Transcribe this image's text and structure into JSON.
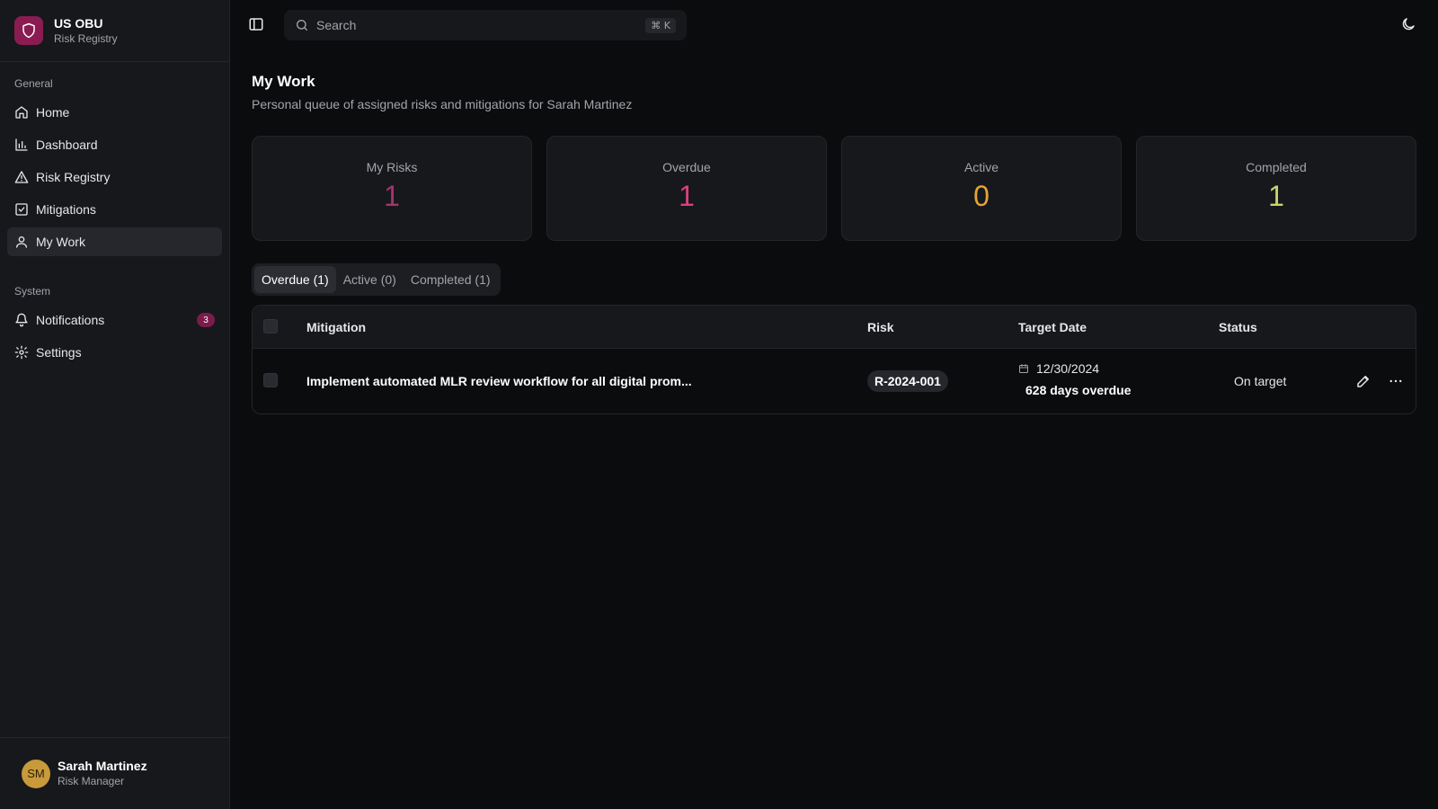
{
  "app": {
    "title": "US OBU",
    "subtitle": "Risk Registry"
  },
  "sidebar": {
    "sections": [
      {
        "heading": "General",
        "items": [
          {
            "label": "Home",
            "icon": "home-icon"
          },
          {
            "label": "Dashboard",
            "icon": "bar-chart-icon"
          },
          {
            "label": "Risk Registry",
            "icon": "warning-icon"
          },
          {
            "label": "Mitigations",
            "icon": "checkbox-icon"
          },
          {
            "label": "My Work",
            "icon": "user-icon",
            "active": true
          }
        ]
      },
      {
        "heading": "System",
        "items": [
          {
            "label": "Notifications",
            "icon": "bell-icon",
            "badge": "3"
          },
          {
            "label": "Settings",
            "icon": "gear-icon"
          }
        ]
      }
    ]
  },
  "user": {
    "initials": "SM",
    "name": "Sarah Martinez",
    "role": "Risk Manager"
  },
  "search": {
    "placeholder": "Search",
    "shortcut": "⌘ K"
  },
  "page": {
    "title": "My Work",
    "subtitle": "Personal queue of assigned risks and mitigations for Sarah Martinez"
  },
  "stats": [
    {
      "label": "My Risks",
      "value": "1",
      "color": "#a6336e"
    },
    {
      "label": "Overdue",
      "value": "1",
      "color": "#d9407e"
    },
    {
      "label": "Active",
      "value": "0",
      "color": "#e3a43a"
    },
    {
      "label": "Completed",
      "value": "1",
      "color": "#c9d36a"
    }
  ],
  "tabs": [
    {
      "label": "Overdue (1)",
      "active": true
    },
    {
      "label": "Active (0)"
    },
    {
      "label": "Completed (1)"
    }
  ],
  "table": {
    "headers": {
      "mitigation": "Mitigation",
      "risk": "Risk",
      "target_date": "Target Date",
      "status": "Status"
    },
    "rows": [
      {
        "mitigation": "Implement automated MLR review workflow for all digital prom...",
        "risk": "R-2024-001",
        "date": "12/30/2024",
        "overdue": "628 days overdue",
        "status": "On target"
      }
    ]
  }
}
